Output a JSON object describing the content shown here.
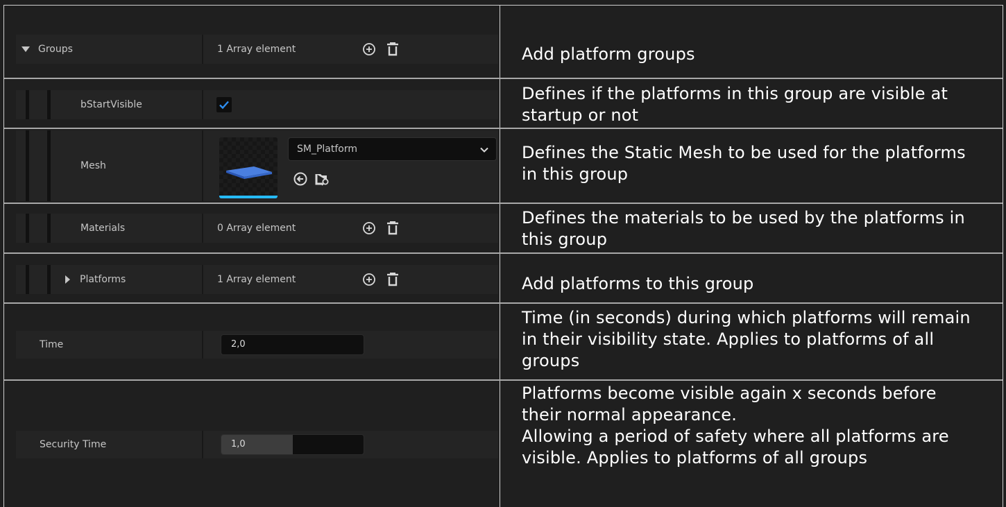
{
  "rows": {
    "groups": {
      "name": "Groups",
      "value": "1 Array element",
      "description": "Add platform groups"
    },
    "bstartvisible": {
      "name": "bStartVisible",
      "checked": true,
      "description": "Defines if the platforms in this group are visible at startup or not"
    },
    "mesh": {
      "name": "Mesh",
      "asset": "SM_Platform",
      "description": "Defines the Static Mesh to be used for the platforms in this group"
    },
    "materials": {
      "name": "Materials",
      "value": "0 Array element",
      "description": "Defines the materials to be used by the platforms in this group"
    },
    "platforms": {
      "name": "Platforms",
      "value": "1 Array element",
      "description": "Add platforms to this group"
    },
    "time": {
      "name": "Time",
      "value": "2,0",
      "description": "Time (in seconds) during which platforms will remain in their visibility state. Applies to platforms of all groups"
    },
    "security_time": {
      "name": "Security Time",
      "value": "1,0",
      "slider_fraction": 0.5,
      "description": "Platforms become visible again x seconds before their normal appearance.\nAllowing a period of safety where all platforms are visible. Applies to platforms of all groups"
    }
  },
  "icons": {
    "add": "add-circle-icon",
    "delete": "trash-icon",
    "use_selected": "use-selected-arrow-icon",
    "browse": "browse-folder-icon",
    "dropdown": "chevron-down-icon",
    "check": "checkmark-icon"
  },
  "colors": {
    "accent": "#26bbff",
    "check": "#2e8ef0"
  }
}
